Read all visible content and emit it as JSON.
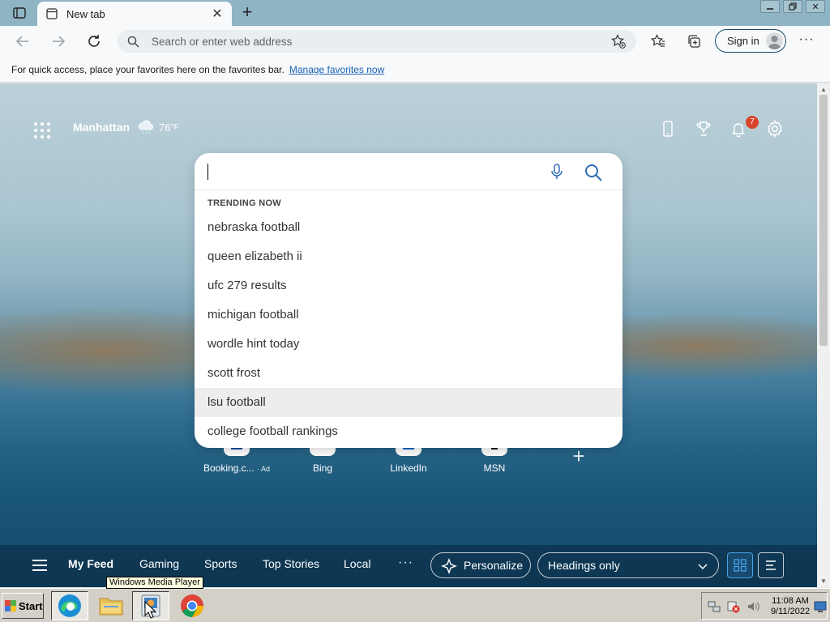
{
  "browser": {
    "tab": {
      "title": "New tab"
    },
    "address_bar": {
      "placeholder": "Search or enter web address"
    },
    "signin_label": "Sign in",
    "favorites_bar": {
      "message": "For quick access, place your favorites here on the favorites bar.",
      "link": "Manage favorites now"
    }
  },
  "newtab": {
    "weather": {
      "location": "Manhattan",
      "temperature": "76",
      "unit": "°F"
    },
    "notification_count": "7",
    "search": {
      "trending_heading": "TRENDING NOW",
      "suggestions": [
        "nebraska football",
        "queen elizabeth ii",
        "ufc 279 results",
        "michigan football",
        "wordle hint today",
        "scott frost",
        "lsu football",
        "college football rankings"
      ],
      "highlighted_suggestion": "lsu football"
    },
    "quick_links": [
      {
        "label": "Booking.c...",
        "ad": "· Ad"
      },
      {
        "label": "Bing"
      },
      {
        "label": "LinkedIn"
      },
      {
        "label": "MSN"
      }
    ],
    "feed": {
      "tabs": [
        "My Feed",
        "Gaming",
        "Sports",
        "Top Stories",
        "Local"
      ],
      "more": "···",
      "personalize_label": "Personalize",
      "layout_select": "Headings only"
    }
  },
  "taskbar": {
    "start_label": "Start",
    "apps": [
      "Microsoft Edge",
      "Windows Explorer",
      "Windows Media Player",
      "Google Chrome"
    ],
    "tooltip": "Windows Media Player",
    "clock": {
      "time": "11:08 AM",
      "date": "9/11/2022"
    }
  },
  "colors": {
    "titlebar": "#8fb4c3",
    "toolbar": "#f7f9fa",
    "link": "#1a5fb4",
    "notification_badge": "#d9452b",
    "taskbar": "#d4d0c8",
    "active_layout_accent": "#4aa3e8"
  },
  "icons": {
    "titlebar": [
      "tab-actions-icon",
      "new-tab-page-icon",
      "close-icon",
      "plus-icon",
      "minimize-icon",
      "restore-icon",
      "close-window-icon"
    ],
    "toolbar": [
      "back-arrow-icon",
      "forward-arrow-icon",
      "refresh-icon",
      "search-icon",
      "add-favorite-star-icon",
      "favorites-icon",
      "collections-icon",
      "avatar-icon",
      "more-dots-icon"
    ],
    "page": [
      "apps-grid-icon",
      "cloud-rain-icon",
      "phone-icon",
      "rewards-trophy-icon",
      "bell-icon",
      "gear-icon",
      "microphone-icon",
      "search-icon",
      "hamburger-icon",
      "sparkle-icon",
      "chevron-down-icon",
      "grid-layout-icon",
      "list-layout-icon"
    ]
  }
}
